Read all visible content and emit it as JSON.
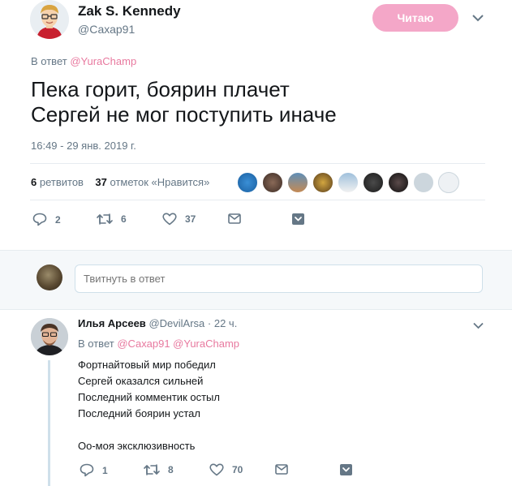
{
  "tweet": {
    "author_name": "Zak S. Kennedy",
    "author_handle": "@Сахар91",
    "follow_label": "Читаю",
    "reply_to_prefix": "В ответ",
    "reply_to_mention": "@YuraChamp",
    "text": "Пека горит, боярин плачет\nСергей не мог поступить иначе",
    "timestamp": "16:49 - 29 янв. 2019 г.",
    "retweets_count": "6",
    "retweets_label": "ретвитов",
    "likes_count": "37",
    "likes_label": "отметок «Нравится»",
    "actions": {
      "replies": "2",
      "retweets": "6",
      "likes": "37"
    }
  },
  "reply_composer": {
    "placeholder": "Твитнуть в ответ"
  },
  "reply": {
    "author_name": "Илья Арсеев",
    "author_handle": "@DevilArsa",
    "separator": "·",
    "time": "22 ч.",
    "reply_to_prefix": "В ответ",
    "reply_to_mentions": "@Сахар91 @YuraChamp",
    "text": "Фортнайтовый мир победил\nСергей оказался сильней\nПоследний комментик остыл\nПоследний боярин устал\n\nОо-моя эксклюзивность",
    "actions": {
      "replies": "1",
      "retweets": "8",
      "likes": "70"
    }
  },
  "colors": {
    "accent_pink": "#f4a7c8",
    "mention_pink": "#e8799f",
    "muted": "#657786",
    "divider": "#e6ecf0"
  }
}
